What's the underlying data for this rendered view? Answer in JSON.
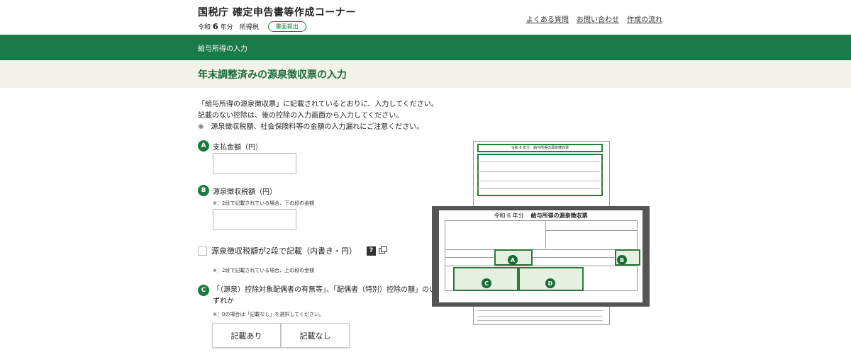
{
  "header": {
    "title": "国税庁 確定申告書等作成コーナー",
    "era": "令和",
    "year": "6",
    "year_suffix": "年分",
    "tax_type": "所得税",
    "badge": "書面提出",
    "links": [
      "よくある質問",
      "お問い合わせ",
      "作成の流れ"
    ]
  },
  "nav": {
    "section": "給与所得の入力"
  },
  "page": {
    "title": "年末調整済みの源泉徴収票の入力"
  },
  "intro": [
    "「給与所得の源泉徴収票」に記載されているとおりに、入力してください。",
    "記載のない控除は、後の控除の入力画面から入力してください。",
    "※　源泉徴収税額、社会保険料等の金額の入力漏れにご注意ください。"
  ],
  "fields": {
    "a": {
      "marker": "A",
      "label": "支払金額（円）",
      "value": ""
    },
    "b": {
      "marker": "B",
      "label": "源泉徴収税額（円）",
      "note": "※：2段で記載されている場合、下の段の金額",
      "value": ""
    },
    "two_tier": {
      "label": "源泉徴収税額が2段で記載（内書き・円）",
      "help": "?",
      "note": "※：2段で記載されている場合、上の段の金額",
      "checked": false
    },
    "c": {
      "marker": "C",
      "label": "「（源泉）控除対象配偶者の有無等」、「配偶者（特別）控除の額」のいずれか",
      "note": "※：0の場合は「記載なし」を選択してください。",
      "options": [
        "記載あり",
        "記載なし"
      ]
    }
  },
  "illustration": {
    "back_title": "令和 6 年分　給与所得の源泉徴収票",
    "zoom_prefix": "令和 6 年分",
    "zoom_title": "給与所得の源泉徴収票",
    "markers": [
      "A",
      "B",
      "C",
      "D"
    ]
  }
}
